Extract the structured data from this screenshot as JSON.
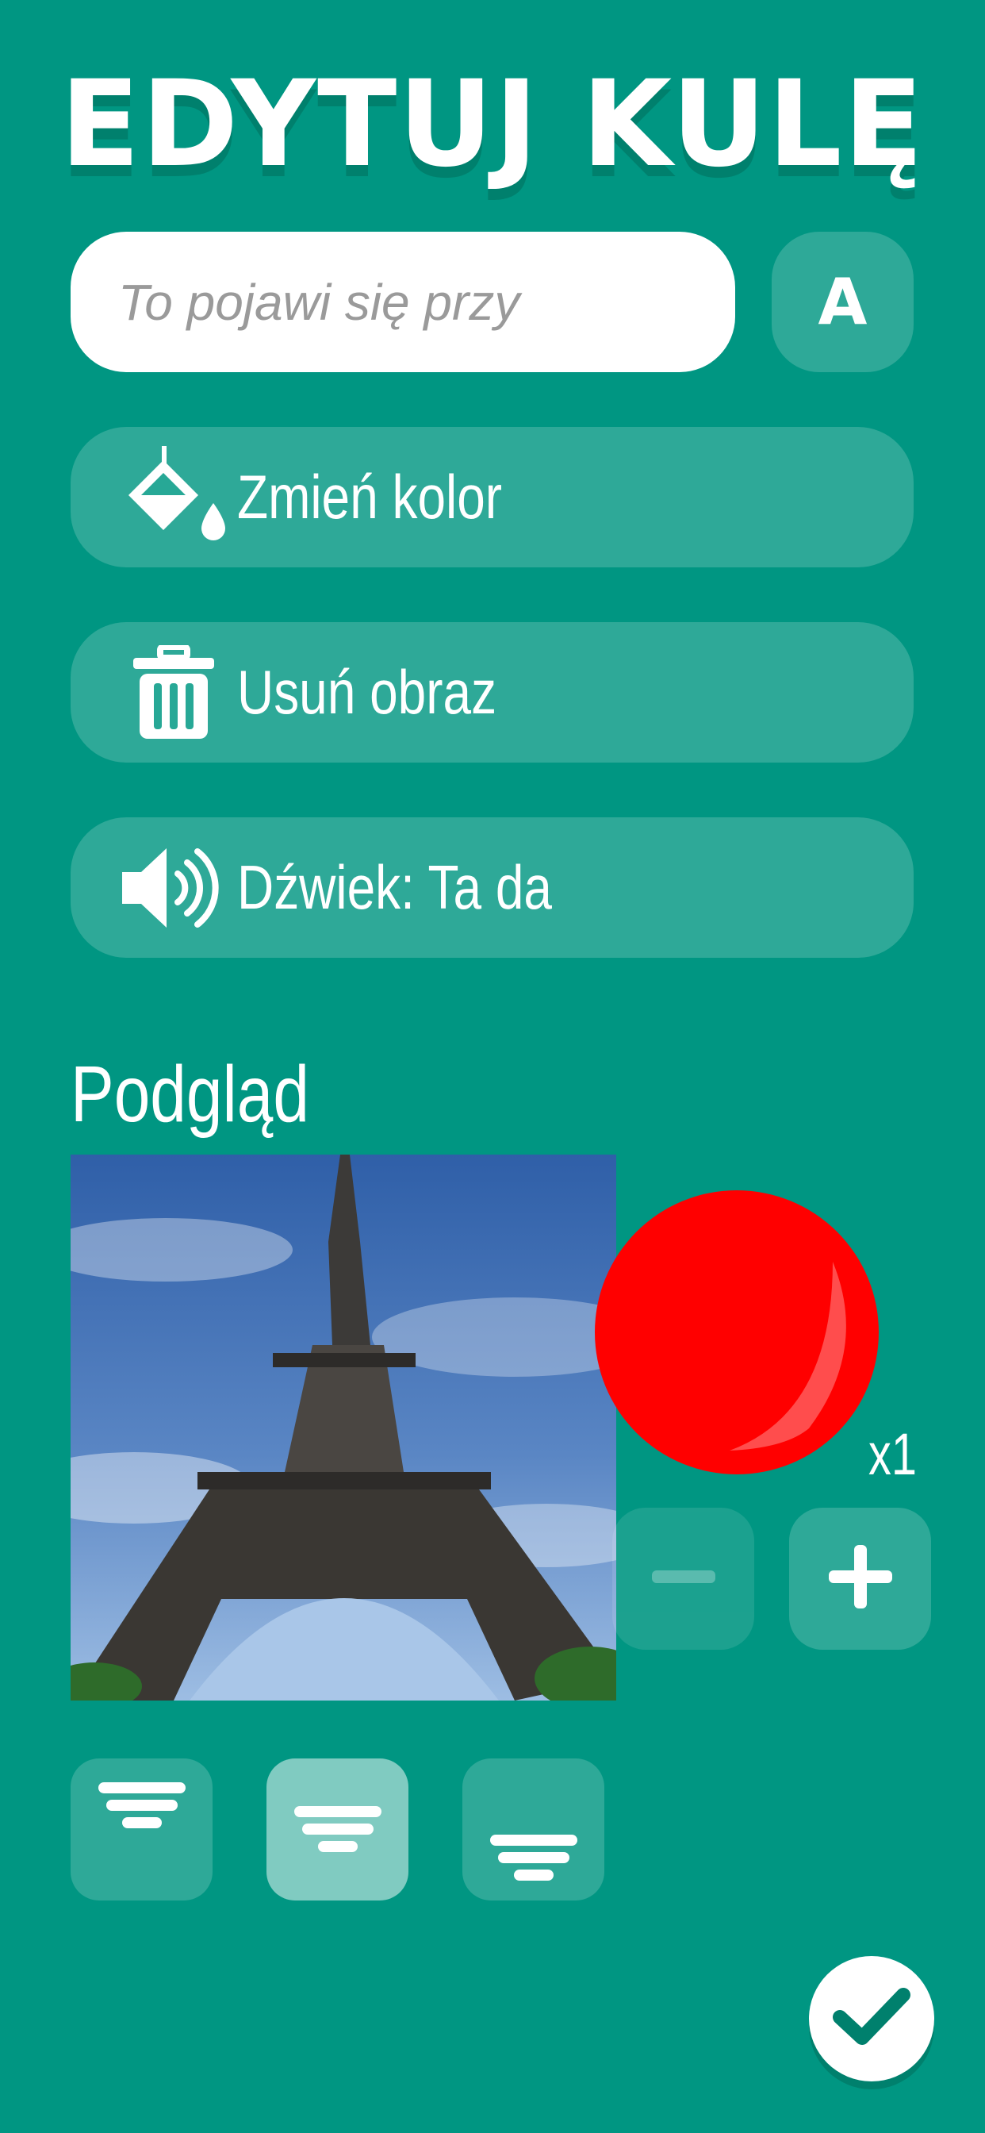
{
  "header": {
    "title": "EDYTUJ KULĘ"
  },
  "text_input": {
    "placeholder": "To pojawi się przy",
    "value": ""
  },
  "font_button": {
    "label": "A"
  },
  "actions": {
    "change_color": "Zmień kolor",
    "remove_image": "Usuń obraz",
    "sound": "Dźwiek: Ta da"
  },
  "preview": {
    "title": "Podgląd",
    "ball_color": "#ff0000",
    "count": "x1"
  },
  "colors": {
    "background": "#009682",
    "button": "rgba(255,255,255,0.18)",
    "active": "rgba(255,255,255,0.5)"
  },
  "alignment": {
    "options": [
      "top",
      "center",
      "bottom"
    ],
    "selected": "center"
  }
}
